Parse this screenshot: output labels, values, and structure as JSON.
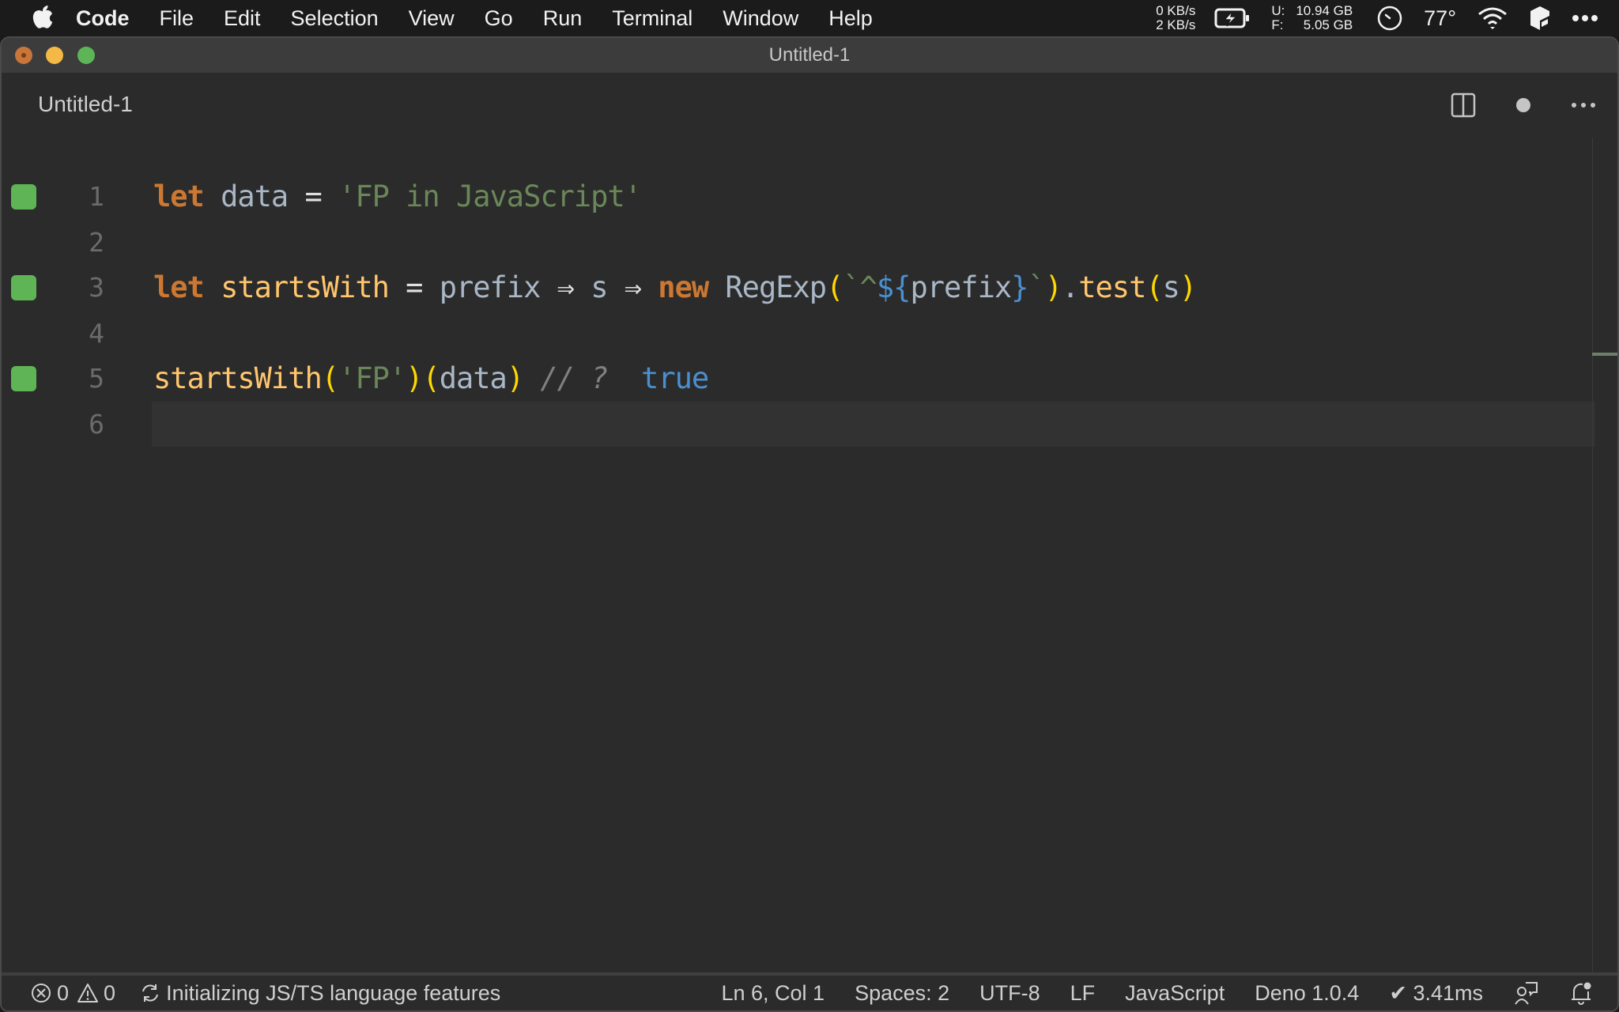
{
  "menubar": {
    "app_name": "Code",
    "items": [
      "File",
      "Edit",
      "Selection",
      "View",
      "Go",
      "Run",
      "Terminal",
      "Window",
      "Help"
    ],
    "network": {
      "up": "0 KB/s",
      "down": "2 KB/s"
    },
    "disk": {
      "used_label": "U:",
      "free_label": "F:",
      "used": "10.94 GB",
      "free": "5.05 GB"
    },
    "temperature": "77°",
    "icons": [
      "apple-icon",
      "battery-charging-icon",
      "clock-icon",
      "wifi-icon",
      "app-status-icon",
      "more-icon"
    ]
  },
  "window": {
    "title": "Untitled-1"
  },
  "tab": {
    "title": "Untitled-1",
    "actions": [
      "split-editor-icon",
      "unsaved-dot-icon",
      "more-actions-icon"
    ]
  },
  "editor": {
    "current_line": 6,
    "lines": [
      {
        "number": "1",
        "marker": true,
        "tokens": [
          {
            "t": "let",
            "c": "kw"
          },
          {
            "t": " ",
            "c": "op"
          },
          {
            "t": "data",
            "c": "var"
          },
          {
            "t": " = ",
            "c": "op"
          },
          {
            "t": "'FP in JavaScript'",
            "c": "str"
          }
        ]
      },
      {
        "number": "2",
        "marker": false,
        "tokens": []
      },
      {
        "number": "3",
        "marker": true,
        "tokens": [
          {
            "t": "let",
            "c": "kw"
          },
          {
            "t": " ",
            "c": "op"
          },
          {
            "t": "startsWith",
            "c": "fn"
          },
          {
            "t": " = ",
            "c": "op"
          },
          {
            "t": "prefix",
            "c": "var"
          },
          {
            "t": " ⇒ ",
            "c": "op"
          },
          {
            "t": "s",
            "c": "var"
          },
          {
            "t": " ⇒ ",
            "c": "op"
          },
          {
            "t": "new",
            "c": "kw"
          },
          {
            "t": " ",
            "c": "op"
          },
          {
            "t": "RegExp",
            "c": "var"
          },
          {
            "t": "(",
            "c": "paren"
          },
          {
            "t": "`^",
            "c": "str"
          },
          {
            "t": "${",
            "c": "interp"
          },
          {
            "t": "prefix",
            "c": "var"
          },
          {
            "t": "}",
            "c": "interp"
          },
          {
            "t": "`",
            "c": "str"
          },
          {
            "t": ")",
            "c": "paren"
          },
          {
            "t": ".",
            "c": "var"
          },
          {
            "t": "test",
            "c": "fn"
          },
          {
            "t": "(",
            "c": "paren"
          },
          {
            "t": "s",
            "c": "var"
          },
          {
            "t": ")",
            "c": "paren"
          }
        ]
      },
      {
        "number": "4",
        "marker": false,
        "tokens": []
      },
      {
        "number": "5",
        "marker": true,
        "tokens": [
          {
            "t": "startsWith",
            "c": "fn"
          },
          {
            "t": "(",
            "c": "paren"
          },
          {
            "t": "'FP'",
            "c": "str"
          },
          {
            "t": ")",
            "c": "paren"
          },
          {
            "t": "(",
            "c": "paren"
          },
          {
            "t": "data",
            "c": "var"
          },
          {
            "t": ")",
            "c": "paren"
          },
          {
            "t": " // ?  ",
            "c": "cmt"
          },
          {
            "t": "true",
            "c": "result"
          }
        ]
      },
      {
        "number": "6",
        "marker": false,
        "tokens": []
      }
    ],
    "marker_color": "#5fb456"
  },
  "statusbar": {
    "errors": "0",
    "warnings": "0",
    "message": "Initializing JS/TS language features",
    "cursor": "Ln 6, Col 1",
    "indent": "Spaces: 2",
    "encoding": "UTF-8",
    "eol": "LF",
    "language": "JavaScript",
    "runtime": "Deno 1.0.4",
    "timing": "✔ 3.41ms"
  }
}
